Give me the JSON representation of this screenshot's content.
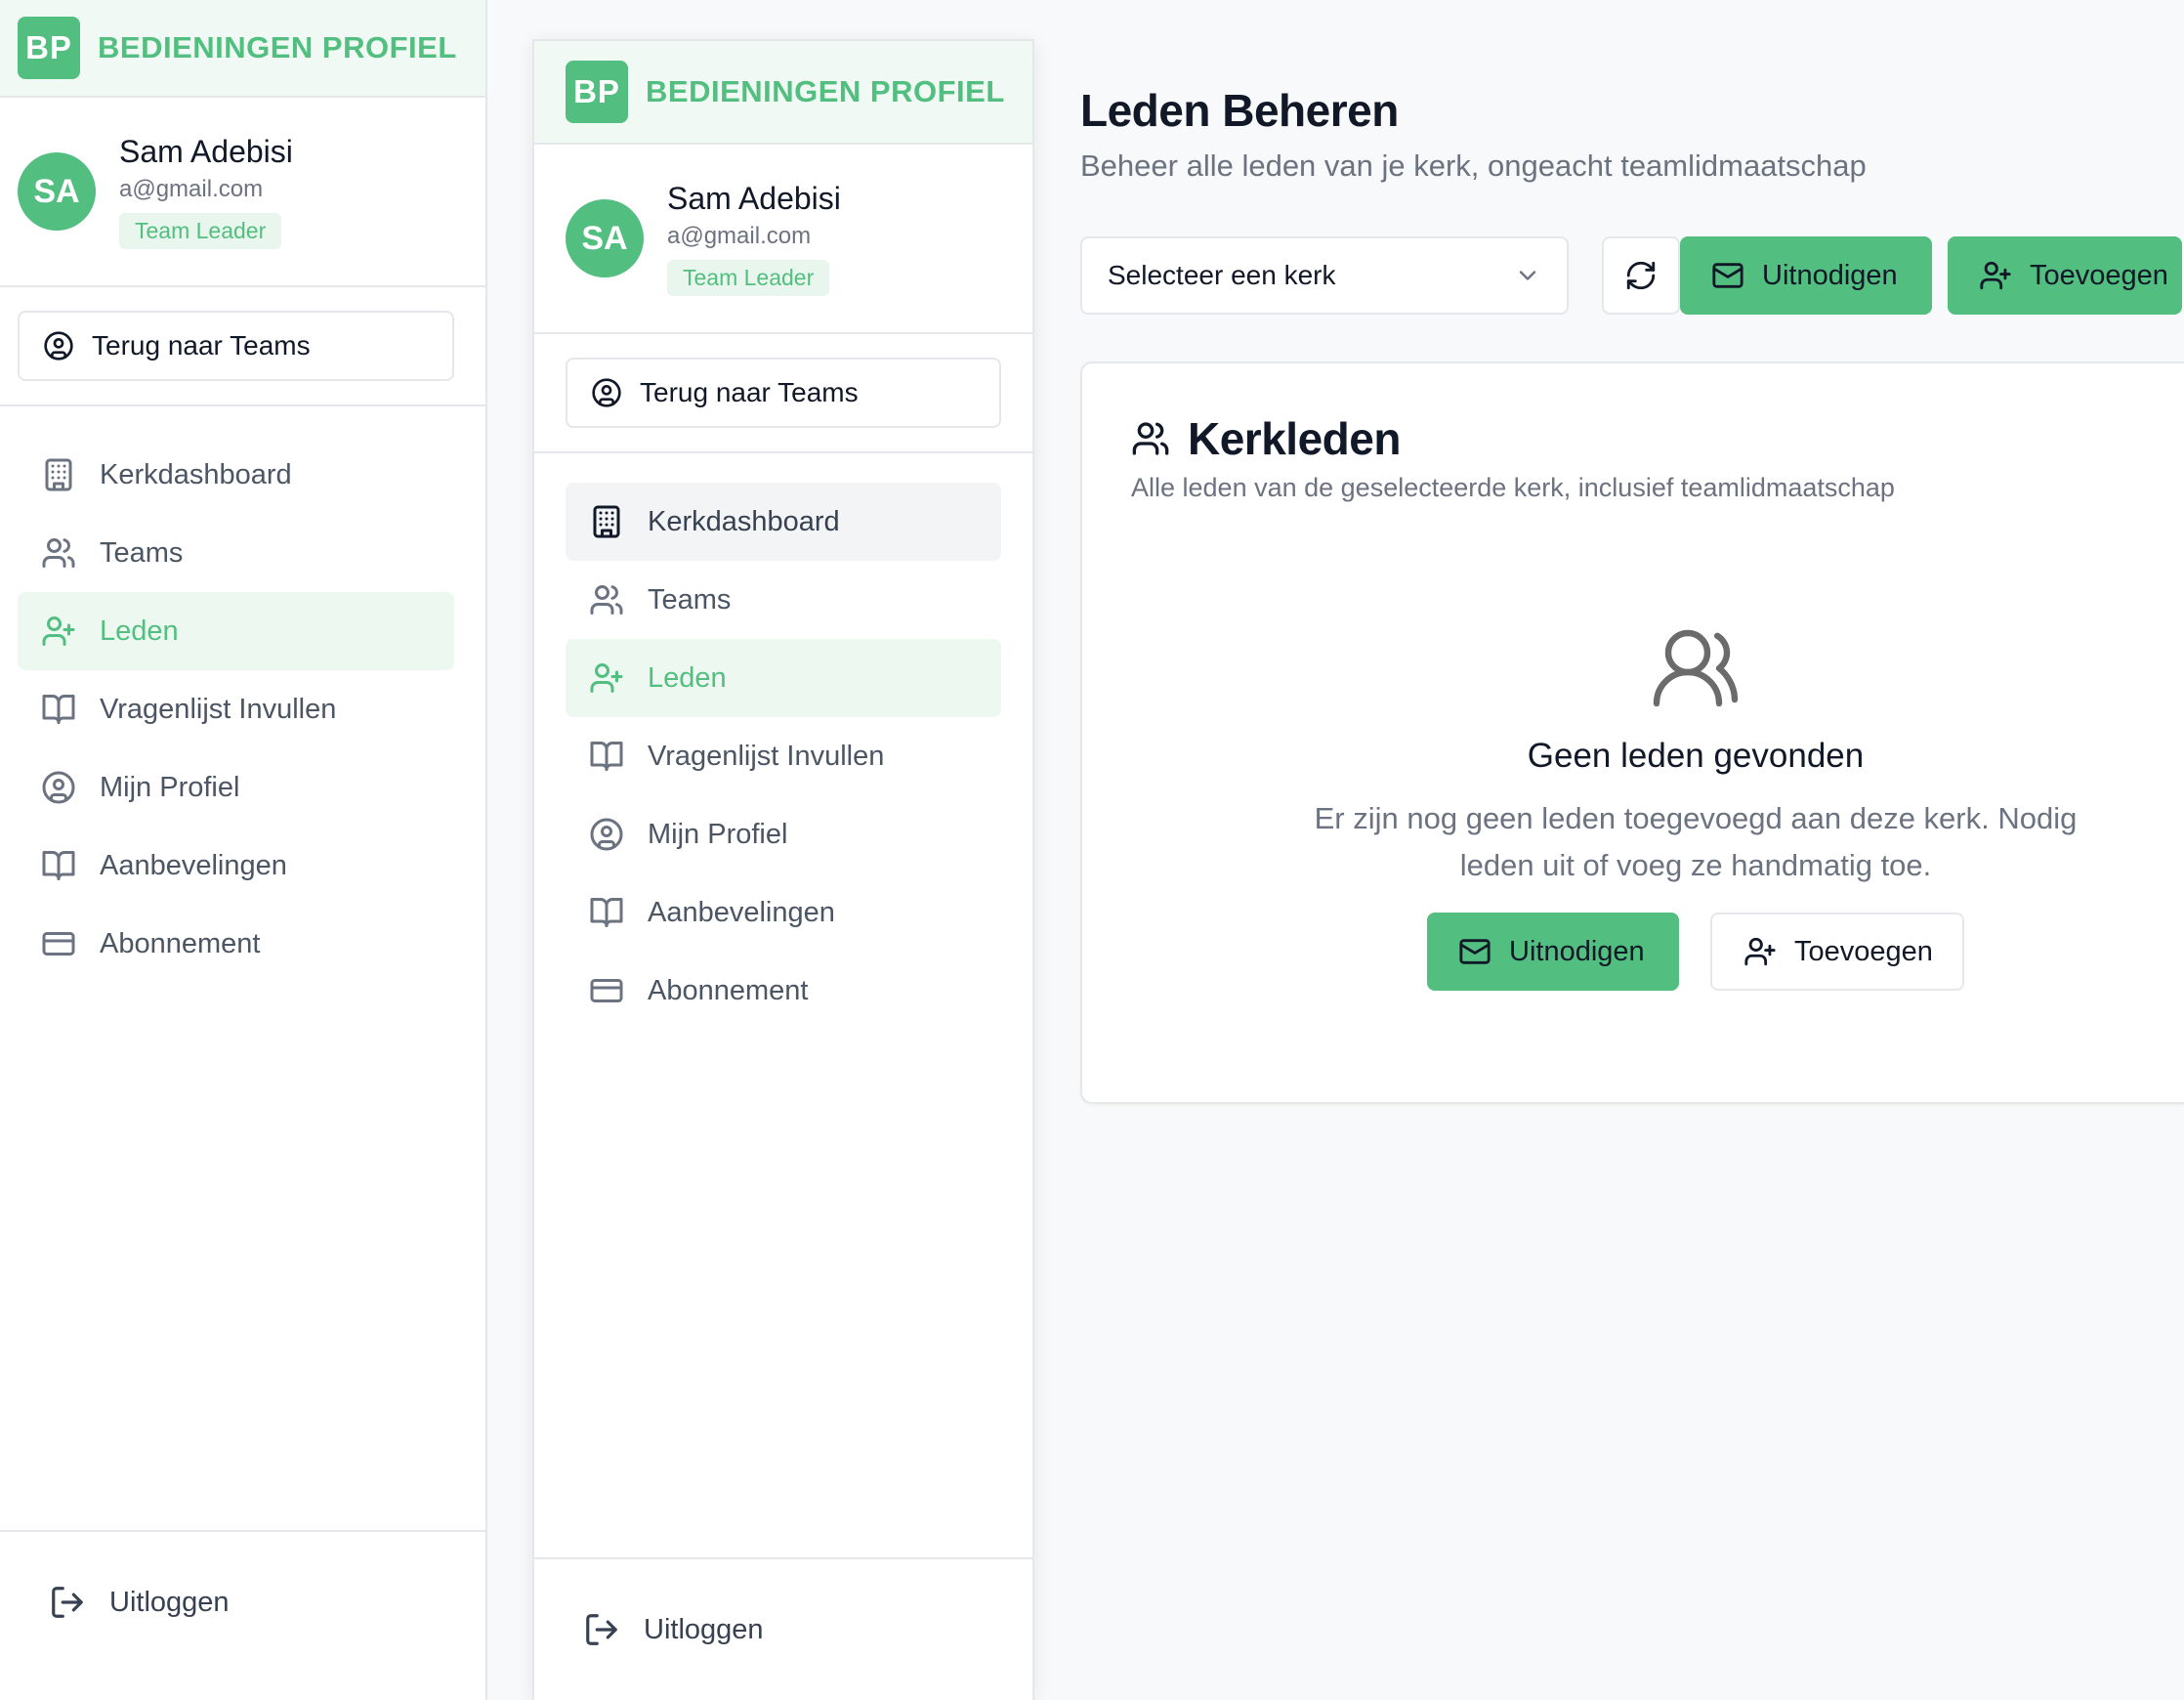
{
  "brand": {
    "logo": "BP",
    "title": "BEDIENINGEN PROFIEL"
  },
  "user": {
    "initials": "SA",
    "name": "Sam Adebisi",
    "email": "a@gmail.com",
    "role": "Team Leader"
  },
  "sidebar": {
    "back_label": "Terug naar Teams",
    "items": [
      {
        "label": "Kerkdashboard",
        "icon": "building-icon"
      },
      {
        "label": "Teams",
        "icon": "users-icon"
      },
      {
        "label": "Leden",
        "icon": "user-plus-icon"
      },
      {
        "label": "Vragenlijst Invullen",
        "icon": "book-open-icon"
      },
      {
        "label": "Mijn Profiel",
        "icon": "user-circle-icon"
      },
      {
        "label": "Aanbevelingen",
        "icon": "book-open-icon"
      },
      {
        "label": "Abonnement",
        "icon": "credit-card-icon"
      }
    ],
    "active_item": "Leden",
    "logout_label": "Uitloggen"
  },
  "page": {
    "title": "Leden Beheren",
    "subtitle": "Beheer alle leden van je kerk, ongeacht teamlidmaatschap"
  },
  "toolbar": {
    "select_value": "Selecteer een kerk",
    "invite_label": "Uitnodigen",
    "add_label": "Toevoegen"
  },
  "card": {
    "title": "Kerkleden",
    "description": "Alle leden van de geselecteerde kerk, inclusief teamlidmaatschap",
    "empty_title": "Geen leden gevonden",
    "empty_text": "Er zijn nog geen leden toegevoegd aan deze kerk. Nodig leden uit of voeg ze handmatig toe.",
    "invite_label": "Uitnodigen",
    "add_label": "Toevoegen"
  },
  "colors": {
    "accent": "#52be7f",
    "accent_bg": "#edf8f1",
    "muted": "#6b7280",
    "border": "#e5e7eb"
  }
}
